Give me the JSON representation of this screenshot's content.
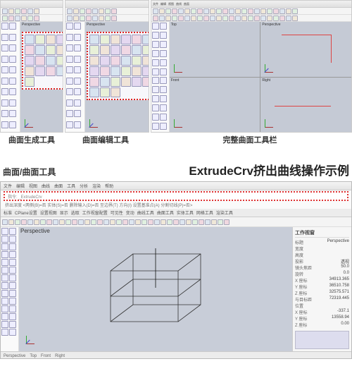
{
  "top_menus": [
    "文件",
    "编辑",
    "视图",
    "曲线",
    "曲面",
    "工具",
    "分析",
    "渲染",
    "帮助"
  ],
  "panel_a": {
    "viewport_label": "Perspective"
  },
  "panel_b": {
    "viewport_label": "Perspective"
  },
  "panel_c": {
    "viewports": [
      "Top",
      "Perspective",
      "Front",
      "Right"
    ]
  },
  "captions": {
    "a": "曲面生成工具",
    "b": "曲面编辑工具",
    "c": "完整曲面工具栏"
  },
  "mid": {
    "left": "曲面/曲面工具",
    "right": "ExtrudeCrv挤出曲线操作示例"
  },
  "bottom": {
    "cmd_line": "指令: _ExtrudeCrv",
    "cmd_opts": "挤出深度 <两侧(B)=否 实体(S)=否 删除输入(D)=否 至边界(T) 方向(I) 设置基准点(A) 分割切线(P)=否>",
    "tabs": [
      "标准",
      "CPlane设置",
      "设置视图",
      "显示",
      "选取",
      "工作视窗配置",
      "可见性",
      "变动",
      "曲线工具",
      "曲面工具",
      "实体工具",
      "网格工具",
      "渲染工具",
      "出图"
    ],
    "viewport_label": "Perspective",
    "right_panel": {
      "title": "工作视窗",
      "rows": [
        [
          "标题",
          "Perspective"
        ],
        [
          "宽度",
          ""
        ],
        [
          "高度",
          ""
        ],
        [
          "投影",
          "透视"
        ],
        [
          "镜头焦距",
          "50.0"
        ],
        [
          "旋转",
          "0.0"
        ],
        [
          "X 座标",
          "34913.365"
        ],
        [
          "Y 座标",
          "36510.758"
        ],
        [
          "Z 座标",
          "32575.571"
        ],
        [
          "与目标距",
          "72319.445"
        ],
        [
          "位置",
          ""
        ],
        [
          "X 座标",
          "-337.1"
        ],
        [
          "Y 座标",
          "13558.94"
        ],
        [
          "Z 座标",
          "0.00"
        ]
      ]
    },
    "status": [
      "Perspective",
      "Top",
      "Front",
      "Right"
    ]
  }
}
